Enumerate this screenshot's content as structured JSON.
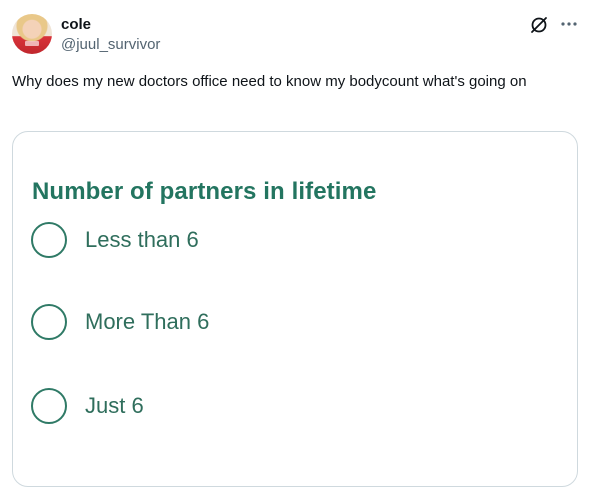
{
  "author": {
    "display_name": "cole",
    "handle": "@juul_survivor",
    "avatar_icon": "profile-photo"
  },
  "actions": {
    "grok_icon": "grok-icon",
    "more_icon": "more-horizontal-icon"
  },
  "tweet": {
    "text": "Why does my new doctors office need to know my bodycount what's going on"
  },
  "media": {
    "form_title": "Number of partners in lifetime",
    "options": [
      {
        "label": "Less than 6",
        "selected": false
      },
      {
        "label": "More Than 6",
        "selected": false
      },
      {
        "label": "Just 6",
        "selected": false
      }
    ],
    "accent_color": "#237560"
  }
}
